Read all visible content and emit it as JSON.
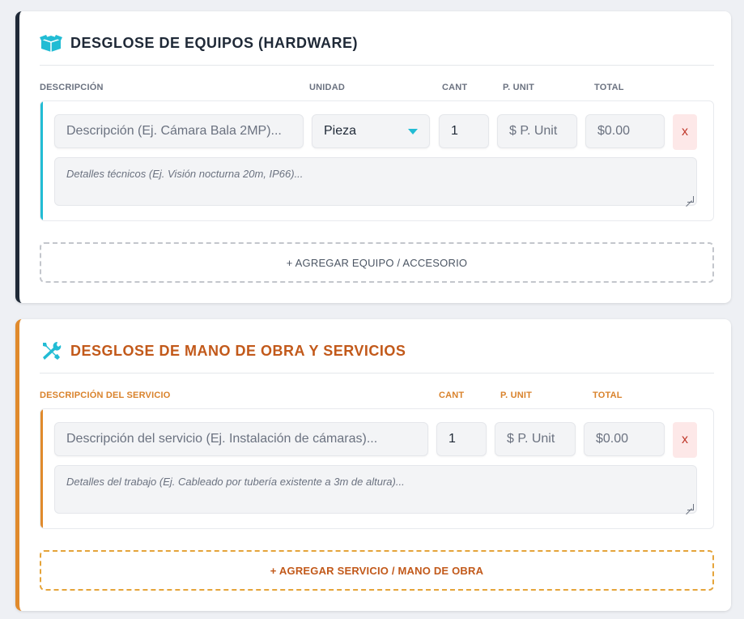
{
  "hardware": {
    "title": "DESGLOSE DE EQUIPOS (HARDWARE)",
    "icon": "box-icon",
    "accent": "#22bcd4",
    "columns": {
      "descripcion": "DESCRIPCIÓN",
      "unidad": "UNIDAD",
      "cant": "CANT",
      "punit": "P. UNIT",
      "total": "TOTAL"
    },
    "item": {
      "description_placeholder": "Descripción (Ej. Cámara Bala 2MP)...",
      "unit_value": "Pieza",
      "qty_value": "1",
      "price_placeholder": "$ P. Unit",
      "total_value": "$0.00",
      "delete_label": "x",
      "details_placeholder": "Detalles técnicos (Ej. Visión nocturna 20m, IP66)..."
    },
    "add_label": "+ AGREGAR EQUIPO / ACCESORIO"
  },
  "services": {
    "title": "DESGLOSE DE MANO DE OBRA Y SERVICIOS",
    "icon": "tools-icon",
    "accent": "#e08a2c",
    "columns": {
      "descripcion": "DESCRIPCIÓN DEL SERVICIO",
      "cant": "CANT",
      "punit": "P. UNIT",
      "total": "TOTAL"
    },
    "item": {
      "description_placeholder": "Descripción del servicio (Ej. Instalación de cámaras)...",
      "qty_value": "1",
      "price_placeholder": "$ P. Unit",
      "total_value": "$0.00",
      "delete_label": "x",
      "details_placeholder": "Detalles del trabajo (Ej. Cableado por tubería existente a 3m de altura)..."
    },
    "add_label": "+ AGREGAR SERVICIO / MANO DE OBRA"
  }
}
